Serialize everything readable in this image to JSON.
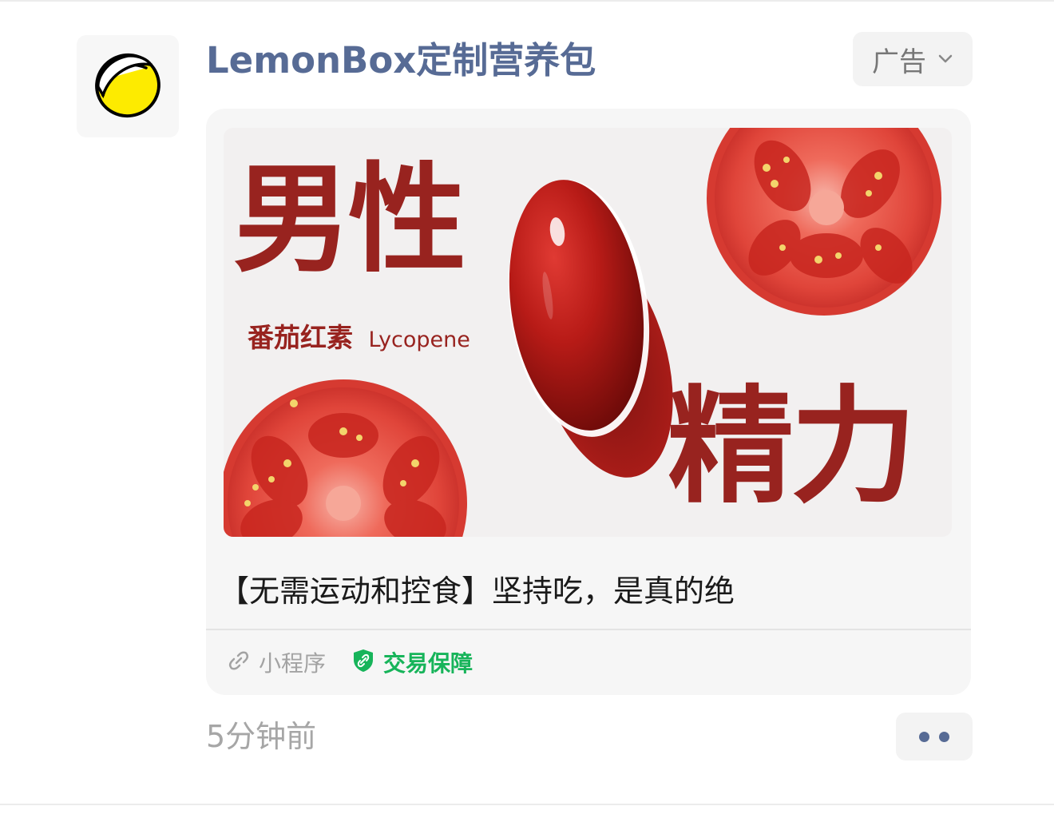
{
  "advertiser": {
    "name": "LemonBox定制营养包",
    "avatar_icon": "lemon-icon"
  },
  "ad_tag": {
    "label": "广告",
    "icon": "chevron-down-icon"
  },
  "banner": {
    "title_top": "男性",
    "subtitle_cn": "番茄红素",
    "subtitle_en": "Lycopene",
    "title_bottom": "精力",
    "colors": {
      "text": "#98231f",
      "background": "#f2f0f0",
      "tomato": "#e0453a",
      "capsule": "#b81b17"
    }
  },
  "headline": "【无需运动和控食】坚持吃，是真的绝",
  "footer": {
    "mini_program_icon": "link-icon",
    "mini_program_label": "小程序",
    "guarantee_icon": "shield-icon",
    "guarantee_label": "交易保障"
  },
  "timestamp": "5分钟前",
  "more_icon": "more-dots-icon",
  "colors": {
    "link_blue": "#576b95",
    "guarantee_green": "#17b45a",
    "muted_gray": "#a6a6a6"
  }
}
